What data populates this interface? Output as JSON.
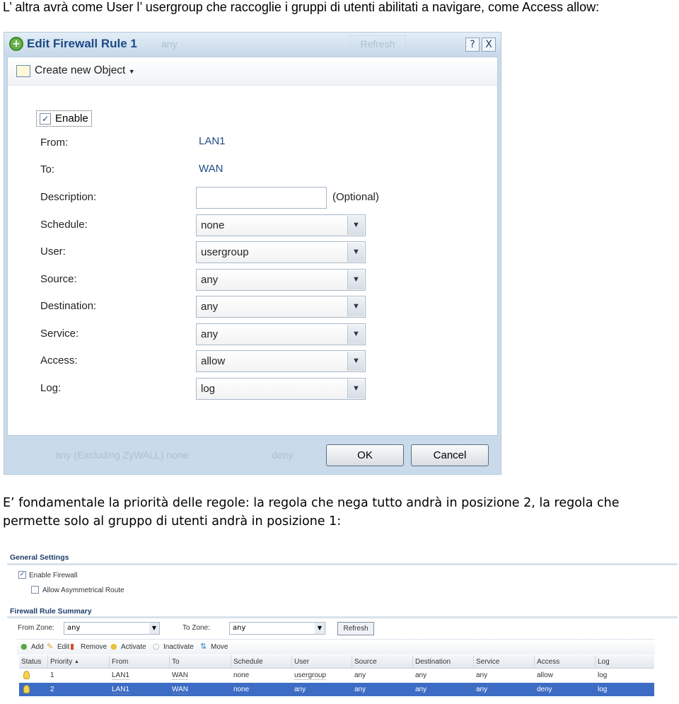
{
  "intro_text": "L’ altra avrà  come User l’ usergroup che raccoglie i gruppi di utenti abilitati a navigare, come Access allow:",
  "dialog": {
    "title": "Edit Firewall Rule 1",
    "help": "?",
    "close": "X",
    "toolbar_label": "Create new Object",
    "enable_label": "Enable",
    "enable_checked": true,
    "from_label": "From:",
    "from_value": "LAN1",
    "to_label": "To:",
    "to_value": "WAN",
    "description_label": "Description:",
    "description_value": "",
    "description_hint": "(Optional)",
    "fields": [
      {
        "label": "Schedule:",
        "value": "none"
      },
      {
        "label": "User:",
        "value": "usergroup"
      },
      {
        "label": "Source:",
        "value": "any"
      },
      {
        "label": "Destination:",
        "value": "any"
      },
      {
        "label": "Service:",
        "value": "any"
      },
      {
        "label": "Access:",
        "value": "allow"
      },
      {
        "label": "Log:",
        "value": "log"
      }
    ],
    "ok": "OK",
    "cancel": "Cancel",
    "background_ghost_top": "any",
    "background_ghost_refresh": "Refresh",
    "background_ghost_bottom": "any (Excluding ZyWALL) none",
    "background_ghost_deny": "deny"
  },
  "paragraph": "E’ fondamentale la priorità delle regole: la regola che nega tutto andrà in posizione 2, la regola che permette solo al gruppo di utenti andrà in posizione 1:",
  "summary": {
    "general_settings": "General Settings",
    "enable_firewall": "Enable Firewall",
    "allow_asym": "Allow Asymmetrical Route",
    "rule_summary": "Firewall Rule Summary",
    "from_zone_label": "From Zone:",
    "from_zone": "any",
    "to_zone_label": "To Zone:",
    "to_zone": "any",
    "refresh": "Refresh",
    "toolbar": [
      "Add",
      "Edit",
      "Remove",
      "Activate",
      "Inactivate",
      "Move"
    ],
    "columns": [
      "Status",
      "Priority",
      "From",
      "To",
      "Schedule",
      "User",
      "Source",
      "Destination",
      "Service",
      "Access",
      "Log"
    ],
    "rows": [
      {
        "priority": "1",
        "from": "LAN1",
        "to": "WAN",
        "schedule": "none",
        "user": "usergroup",
        "source": "any",
        "destination": "any",
        "service": "any",
        "access": "allow",
        "log": "log",
        "selected": false
      },
      {
        "priority": "2",
        "from": "LAN1",
        "to": "WAN",
        "schedule": "none",
        "user": "any",
        "source": "any",
        "destination": "any",
        "service": "any",
        "access": "deny",
        "log": "log",
        "selected": true
      }
    ],
    "selected_color": "#3d6cc4"
  }
}
